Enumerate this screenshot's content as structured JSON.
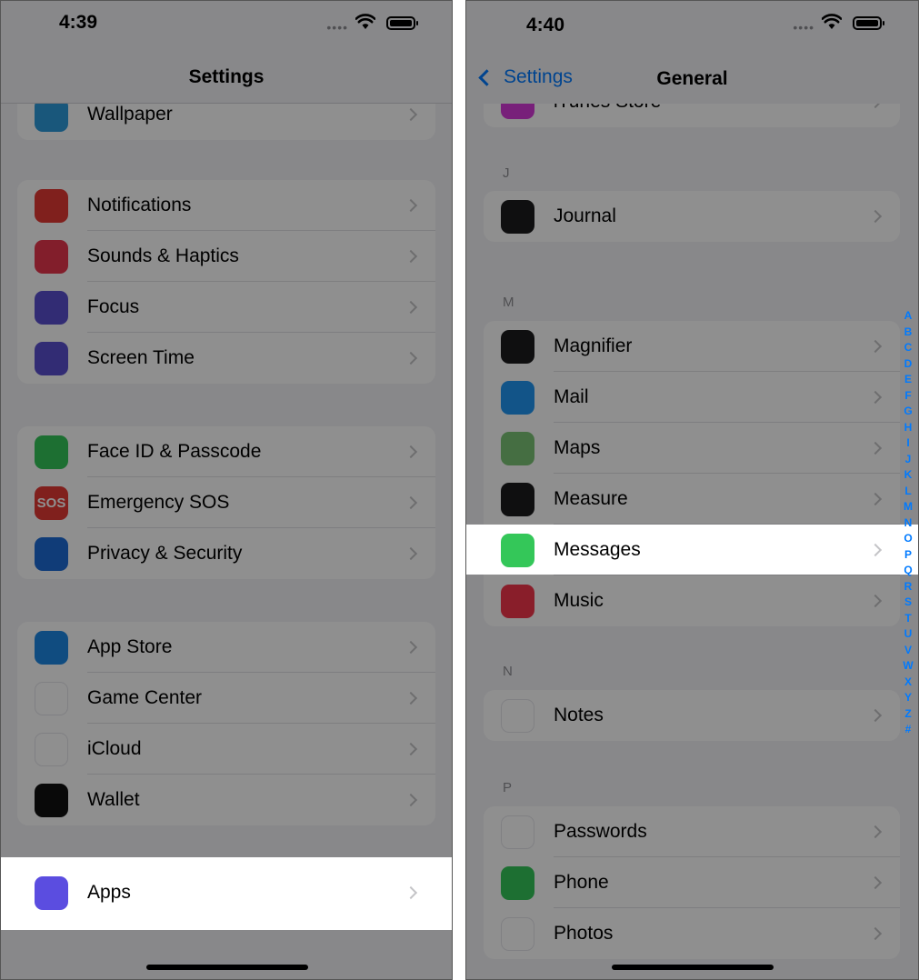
{
  "left": {
    "status_time": "4:39",
    "nav_title": "Settings",
    "groups": [
      [
        {
          "label": "Wallpaper",
          "icon": "wallpaper-icon",
          "color": "#2d9cdb"
        }
      ],
      [
        {
          "label": "Notifications",
          "icon": "notifications-icon",
          "color": "#e53935"
        },
        {
          "label": "Sounds & Haptics",
          "icon": "speaker-icon",
          "color": "#e8364d"
        },
        {
          "label": "Focus",
          "icon": "moon-icon",
          "color": "#5a4fcf"
        },
        {
          "label": "Screen Time",
          "icon": "hourglass-icon",
          "color": "#5a4fcf"
        }
      ],
      [
        {
          "label": "Face ID & Passcode",
          "icon": "face-id-icon",
          "color": "#34c759"
        },
        {
          "label": "Emergency SOS",
          "icon": "sos-icon",
          "color": "#e53935",
          "glyph": "SOS"
        },
        {
          "label": "Privacy & Security",
          "icon": "hand-icon",
          "color": "#1e6bd6"
        }
      ],
      [
        {
          "label": "App Store",
          "icon": "app-store-icon",
          "color": "#1e88e5"
        },
        {
          "label": "Game Center",
          "icon": "game-center-icon",
          "color": "#ffffff"
        },
        {
          "label": "iCloud",
          "icon": "icloud-icon",
          "color": "#ffffff"
        },
        {
          "label": "Wallet",
          "icon": "wallet-icon",
          "color": "#111111"
        }
      ],
      [
        {
          "label": "Apps",
          "icon": "apps-grid-icon",
          "color": "#5b4de0"
        }
      ]
    ]
  },
  "right": {
    "status_time": "4:40",
    "back_label": "Settings",
    "nav_title": "General",
    "top_partial": {
      "label": "iTunes Store",
      "icon": "itunes-icon",
      "color": "#d63ad9"
    },
    "sections": [
      {
        "letter": "J",
        "items": [
          {
            "label": "Journal",
            "icon": "journal-icon",
            "color": "#1c1c1e"
          }
        ]
      },
      {
        "letter": "M",
        "items": [
          {
            "label": "Magnifier",
            "icon": "magnifier-icon",
            "color": "#1c1c1e"
          },
          {
            "label": "Mail",
            "icon": "mail-icon",
            "color": "#2196f3"
          },
          {
            "label": "Maps",
            "icon": "maps-icon",
            "color": "#7cc576"
          },
          {
            "label": "Measure",
            "icon": "measure-icon",
            "color": "#1c1c1e"
          },
          {
            "label": "Messages",
            "icon": "messages-icon",
            "color": "#34c759"
          },
          {
            "label": "Music",
            "icon": "music-icon",
            "color": "#f5364b"
          }
        ]
      },
      {
        "letter": "N",
        "items": [
          {
            "label": "Notes",
            "icon": "notes-icon",
            "color": "#ffffff"
          }
        ]
      },
      {
        "letter": "P",
        "items": [
          {
            "label": "Passwords",
            "icon": "passwords-icon",
            "color": "#ffffff"
          },
          {
            "label": "Phone",
            "icon": "phone-icon",
            "color": "#34c759"
          },
          {
            "label": "Photos",
            "icon": "photos-icon",
            "color": "#ffffff"
          }
        ]
      }
    ],
    "index_letters": [
      "A",
      "B",
      "C",
      "D",
      "E",
      "F",
      "G",
      "H",
      "I",
      "J",
      "K",
      "L",
      "M",
      "N",
      "O",
      "P",
      "Q",
      "R",
      "S",
      "T",
      "U",
      "V",
      "W",
      "X",
      "Y",
      "Z",
      "#"
    ]
  }
}
